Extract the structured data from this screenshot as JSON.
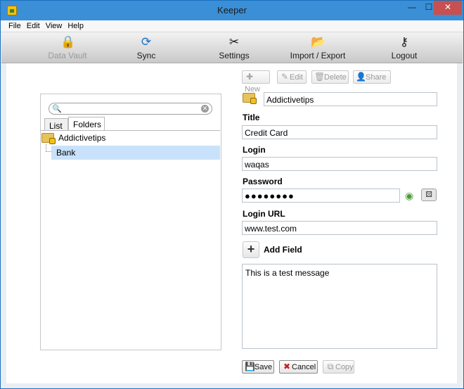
{
  "window": {
    "title": "Keeper",
    "min_glyph": "—",
    "max_glyph": "☐",
    "close_glyph": "✕"
  },
  "menu": {
    "items": [
      "File",
      "Edit",
      "View",
      "Help"
    ]
  },
  "toolbar": {
    "data_vault": "Data Vault",
    "sync": "Sync",
    "settings": "Settings",
    "import_export": "Import / Export",
    "logout": "Logout"
  },
  "search": {
    "value": "",
    "placeholder": ""
  },
  "tabs": {
    "list": "List",
    "folders": "Folders"
  },
  "tree": {
    "root": "Addictivetips",
    "child": "Bank"
  },
  "record_toolbar": {
    "new": "New",
    "edit": "Edit",
    "delete": "Delete",
    "share": "Share"
  },
  "record": {
    "folder": "Addictivetips",
    "title_label": "Title",
    "title": "Credit Card",
    "login_label": "Login",
    "login": "waqas",
    "password_label": "Password",
    "password_masked": "●●●●●●●●",
    "url_label": "Login URL",
    "url": "www.test.com",
    "add_field": "Add Field",
    "notes": "This is a test message"
  },
  "actions": {
    "save": "Save",
    "cancel": "Cancel",
    "copy": "Copy"
  }
}
